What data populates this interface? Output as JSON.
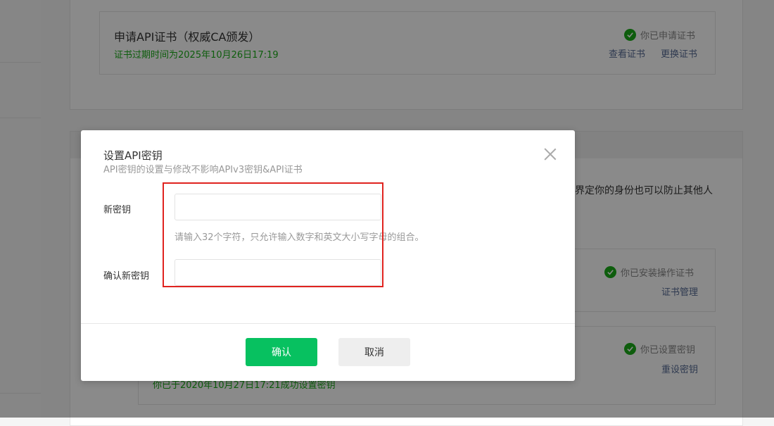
{
  "background": {
    "cert_card": {
      "title": "申请API证书（权威CA颁发）",
      "expiry": "证书过期时间为2025年10月26日17:19",
      "status": "你已申请证书",
      "link_view": "查看证书",
      "link_replace": "更换证书"
    },
    "desc_text": "界定你的身份也可以防止其他人",
    "op_cert_card": {
      "status": "你已安装操作证书",
      "link": "证书管理"
    },
    "key_card": {
      "status": "你已设置密钥",
      "link": "重设密钥",
      "note": "你已于2020年10月27日17:21成功设置密钥"
    }
  },
  "modal": {
    "title": "设置API密钥",
    "description": "API密钥的设置与修改不影响APIv3密钥&API证书",
    "fields": [
      {
        "label": "新密钥",
        "value": "",
        "placeholder": ""
      },
      {
        "label": "确认新密钥",
        "value": "",
        "placeholder": ""
      }
    ],
    "hint": "请输入32个字符，只允许输入数字和英文大小写字母的组合。",
    "confirm_label": "确认",
    "cancel_label": "取消"
  },
  "colors": {
    "accent": "#07c160",
    "success": "#1aad19",
    "link": "#576b95",
    "highlight": "#e0231f"
  },
  "icons": {
    "status": "check-circle-icon",
    "close": "close-icon"
  }
}
